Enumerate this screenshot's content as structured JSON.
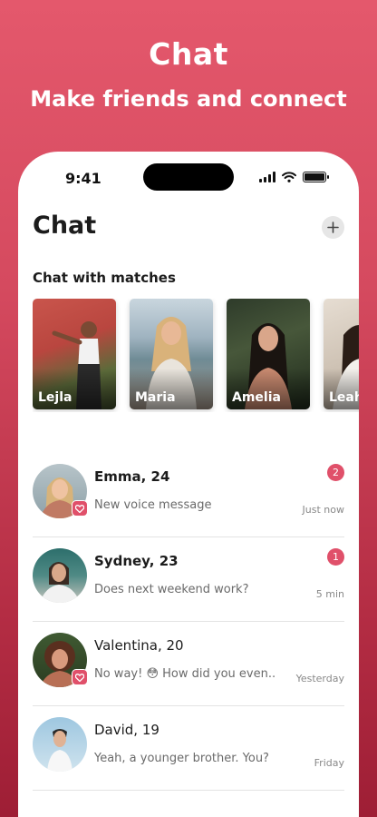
{
  "promo": {
    "title": "Chat",
    "subtitle": "Make friends and connect"
  },
  "status_bar": {
    "time": "9:41"
  },
  "header": {
    "title": "Chat",
    "add_icon": "plus-icon"
  },
  "matches": {
    "section_title": "Chat with matches",
    "items": [
      {
        "name": "Lejla"
      },
      {
        "name": "Maria"
      },
      {
        "name": "Amelia"
      },
      {
        "name": "Leah"
      }
    ]
  },
  "chats": [
    {
      "name": "Emma, 24",
      "preview": "New voice message",
      "time": "Just now",
      "unread": "2",
      "match": true
    },
    {
      "name": "Sydney, 23",
      "preview": "Does next weekend work?",
      "time": "5 min",
      "unread": "1",
      "match": false
    },
    {
      "name": "Valentina, 20",
      "preview": "No way! 😳 How did you even..",
      "time": "Yesterday",
      "unread": "",
      "match": true
    },
    {
      "name": "David, 19",
      "preview": "Yeah, a younger brother. You?",
      "time": "Friday",
      "unread": "",
      "match": false
    }
  ],
  "colors": {
    "accent": "#e0506a",
    "background_top": "#e4586c",
    "background_bottom": "#9e1e35"
  }
}
